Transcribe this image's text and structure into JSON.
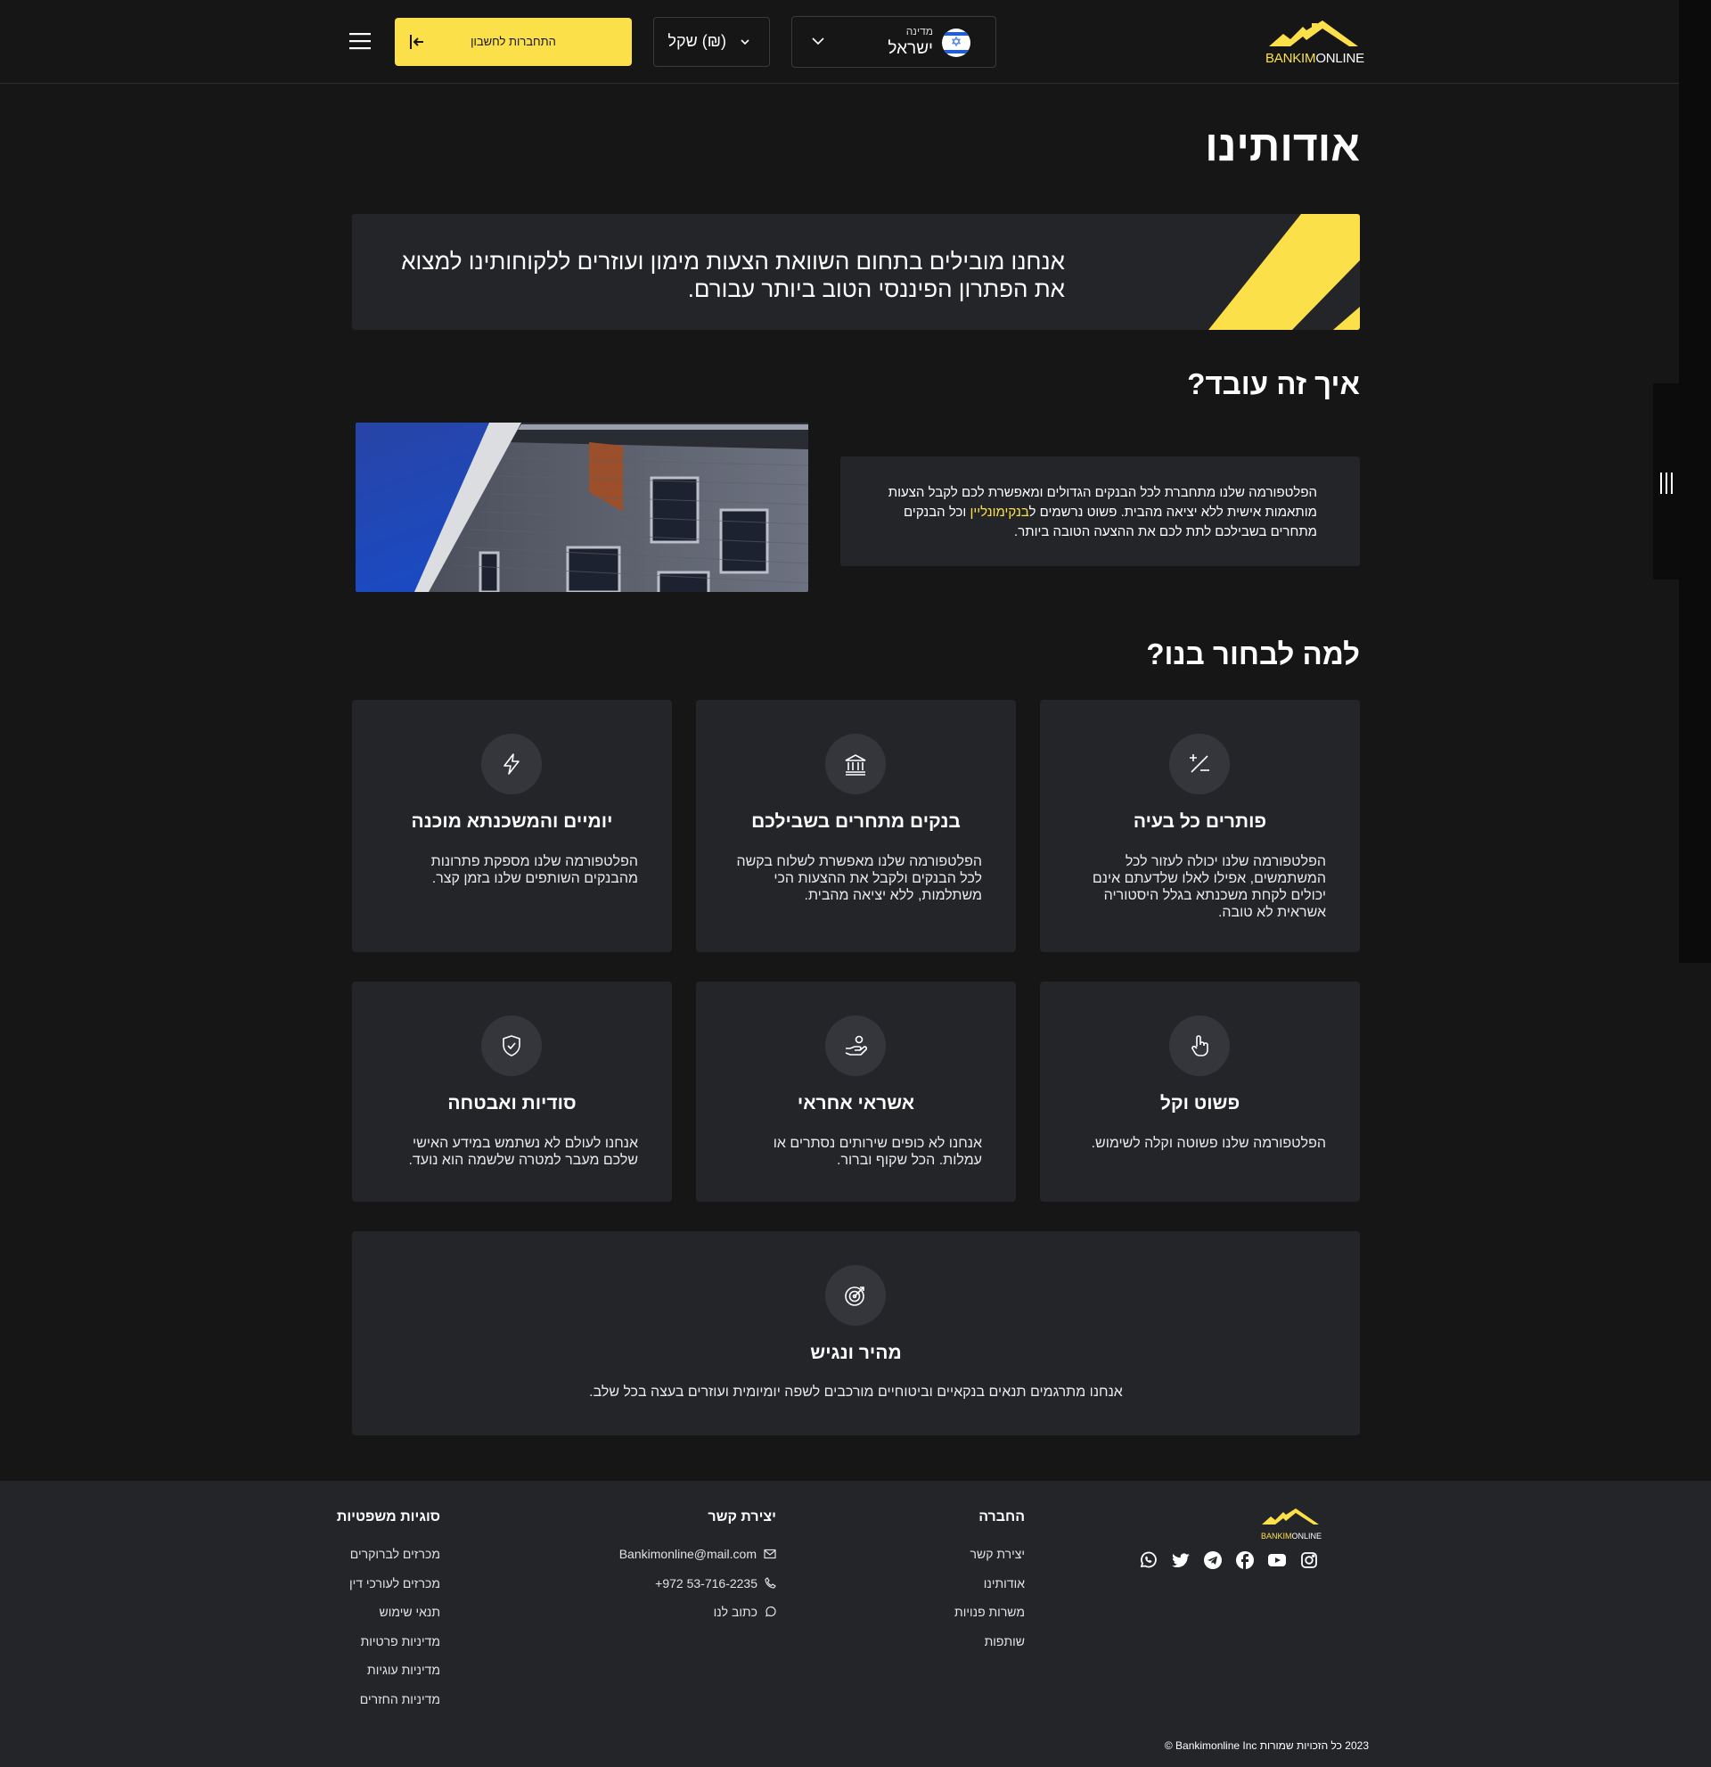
{
  "header": {
    "logo": {
      "part1": "BANKIM",
      "part2": "ONLINE"
    },
    "country": {
      "label": "מדינה",
      "value": "ישראל"
    },
    "currency": {
      "label": "שקל (₪)"
    },
    "login_label": "התחברות לחשבון",
    "icons": {
      "menu": "hamburger-menu-icon",
      "login": "login-arrow-icon",
      "chevron": "chevron-down-icon",
      "flag": "israel-flag-icon"
    }
  },
  "main": {
    "title": "אודותינו",
    "hero_text": "אנחנו מובילים בתחום השוואת הצעות מימון ועוזרים ללקוחותינו למצוא את הפתרון הפיננסי הטוב ביותר עבורם.",
    "how_title": "איך זה עובד?",
    "how_text_part1": "הפלטפורמה שלנו מתחברת לכל הבנקים הגדולים ומאפשרת לכם לקבל הצעות מותאמות אישית ללא יציאה מהבית. פשוט נרשמים ל",
    "how_text_highlight": "בנקימונליין",
    "how_text_part2": " וכל הבנקים מתחרים בשבילכם לתת לכם את ההצעה הטובה ביותר.",
    "why_title": "למה לבחור בנו?",
    "features": [
      {
        "title": "פותרים כל בעיה",
        "desc": "הפלטפורמה שלנו יכולה לעזור לכל המשתמשים, אפילו לאלו שלדעתם אינם יכולים לקחת משכנתא בגלל היסטוריה אשראית לא טובה.",
        "icon": "plus-minus-icon"
      },
      {
        "title": "בנקים מתחרים בשבילכם",
        "desc": "הפלטפורמה שלנו מאפשרת לשלוח בקשה לכל הבנקים ולקבל את ההצעות הכי משתלמות, ללא יציאה מהבית.",
        "icon": "bank-icon"
      },
      {
        "title": "יומיים והמשכנתא מוכנה",
        "desc": "הפלטפורמה שלנו מספקת פתרונות מהבנקים השותפים שלנו בזמן קצר.",
        "icon": "lightning-icon"
      },
      {
        "title": "פשוט וקל",
        "desc": "הפלטפורמה שלנו פשוטה וקלה לשימוש.",
        "icon": "pointer-hand-icon"
      },
      {
        "title": "אשראי אחראי",
        "desc": "אנחנו לא כופים שירותים נסתרים או עמלות. הכל שקוף וברור.",
        "icon": "hand-coin-icon"
      },
      {
        "title": "סודיות ואבטחה",
        "desc": "אנחנו לעולם לא נשתמש במידע האישי שלכם מעבר למטרה שלשמה הוא נועד.",
        "icon": "shield-check-icon"
      },
      {
        "title": "מהיר ונגיש",
        "desc": "אנחנו מתרגמים תנאים בנקאיים וביטוחיים מורכבים לשפה יומיומית ועוזרים בעצה בכל שלב.",
        "icon": "target-icon"
      }
    ]
  },
  "footer": {
    "company": {
      "title": "החברה",
      "items": [
        "יצירת קשר",
        "אודותינו",
        "משרות פנויות",
        "שותפות"
      ]
    },
    "contact": {
      "title": "יצירת קשר",
      "email": "Bankimonline@mail.com",
      "phone": "+972 53-716-2235",
      "write": "כתוב לנו"
    },
    "legal": {
      "title": "סוגיות משפטיות",
      "items": [
        "מכרזים לברוקרים",
        "מכרזים לעורכי דין",
        "תנאי שימוש",
        "מדיניות פרטיות",
        "מדיניות עוגיות",
        "מדיניות החזרים"
      ]
    },
    "copyright": "2023 כל הזכויות שמורות Bankimonline Inc ©",
    "social_icons": [
      "instagram-icon",
      "youtube-icon",
      "facebook-icon",
      "telegram-icon",
      "twitter-icon",
      "whatsapp-icon"
    ]
  },
  "colors": {
    "accent": "#fbe04a",
    "background": "#161616",
    "card": "#242529"
  }
}
